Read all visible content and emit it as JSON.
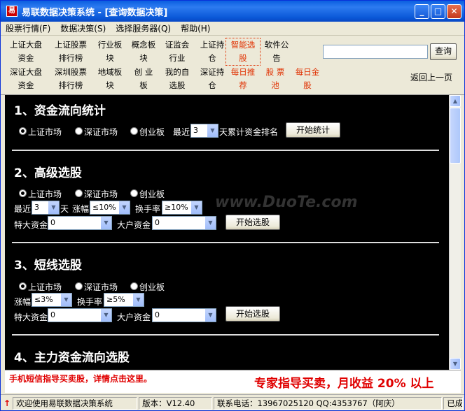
{
  "window": {
    "title": "易联数据决策系统 - [查询数据决策]",
    "min": "_",
    "max": "□",
    "close": "✕"
  },
  "menu": [
    "股票行情(F)",
    "数据决策(S)",
    "选择服务器(Q)",
    "帮助(H)"
  ],
  "toolbar": {
    "row1": [
      "上证大盘",
      "上证股票",
      "行业板",
      "概念板",
      "证监会",
      "上证持",
      "智能选",
      "软件公"
    ],
    "row1b": [
      "资金",
      "排行榜",
      "块",
      "块",
      "行业",
      "仓",
      "股",
      "告"
    ],
    "row2": [
      "深证大盘",
      "深圳股票",
      "地域板",
      "创 业",
      "我的自",
      "深证持",
      "每日推",
      "股 票",
      "每日金"
    ],
    "row2b": [
      "资金",
      "排行榜",
      "块",
      "板",
      "选股",
      "仓",
      "荐",
      "池",
      "股"
    ],
    "search_btn": "查询",
    "back": "返回上一页"
  },
  "sections": [
    {
      "title": "1、资金流向统计",
      "radios": [
        "上证市场",
        "深证市场",
        "创业板"
      ],
      "recent": "最近",
      "days": "3",
      "suffix": "天累计资金排名",
      "action": "开始统计"
    },
    {
      "title": "2、高级选股",
      "radios": [
        "上证市场",
        "深证市场",
        "创业板"
      ],
      "recent": "最近",
      "days": "3",
      "day_unit": "天",
      "rise_label": "涨幅",
      "rise": "≤10%",
      "turnover_label": "换手率",
      "turnover": "≥10%",
      "big_label": "特大资金",
      "big": "0",
      "house_label": "大户资金",
      "house": "0",
      "action": "开始选股"
    },
    {
      "title": "3、短线选股",
      "radios": [
        "上证市场",
        "深证市场",
        "创业板"
      ],
      "rise_label": "涨幅",
      "rise": "≤3%",
      "turnover_label": "换手率",
      "turnover": "≥5%",
      "big_label": "特大资金",
      "big": "0",
      "house_label": "大户资金",
      "house": "0",
      "action": "开始选股"
    },
    {
      "title": "4、主力资金流向选股"
    }
  ],
  "watermark": "www.DuoTe.com",
  "ads": {
    "left": "手机短信指导买卖股，详情点击这里。",
    "right": "专家指导买卖，月收益 20% 以上"
  },
  "status": {
    "welcome": "欢迎使用易联数据决策系统",
    "version": "版本：V12.40",
    "contact": "联系电话：13967025120 QQ:4353767（阿庆）",
    "state": "已成"
  }
}
